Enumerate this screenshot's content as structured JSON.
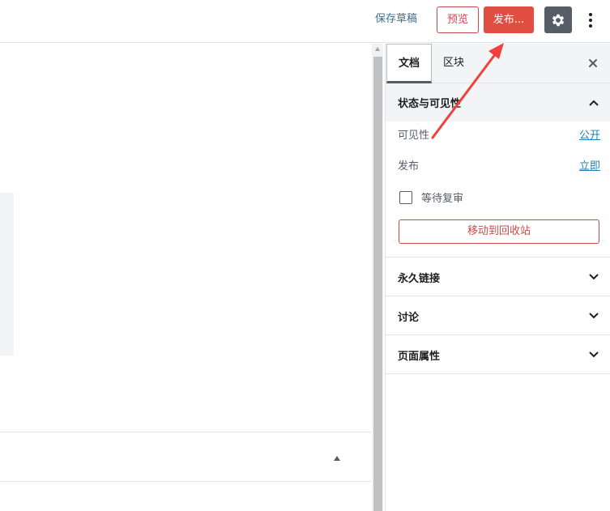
{
  "header": {
    "save_draft": "保存草稿",
    "preview": "预览",
    "publish": "发布...",
    "settings_icon": "gear-icon",
    "more_icon": "more-vertical-icon"
  },
  "sidebar": {
    "tabs": [
      {
        "label": "文档",
        "active": true
      },
      {
        "label": "区块",
        "active": false
      }
    ],
    "close_icon": "close-icon",
    "status_panel": {
      "title": "状态与可见性",
      "visibility_label": "可见性",
      "visibility_value": "公开",
      "publish_label": "发布",
      "publish_value": "立即",
      "pending_review_label": "等待复审",
      "pending_review_checked": false,
      "trash_button": "移动到回收站"
    },
    "panels": [
      {
        "title": "永久链接"
      },
      {
        "title": "讨论"
      },
      {
        "title": "页面属性"
      }
    ]
  },
  "colors": {
    "accent_red": "#e04d41",
    "link_blue": "#1f7fb5",
    "gear_bg": "#555d66",
    "annotation_arrow": "#f0413c"
  }
}
